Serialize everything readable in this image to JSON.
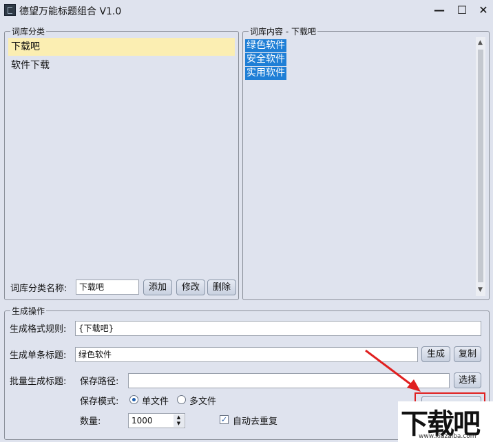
{
  "window": {
    "title": "德望万能标题组合 V1.0",
    "minimize": "—",
    "maximize": "☐",
    "close": "✕"
  },
  "category_panel": {
    "legend": "词库分类",
    "items": [
      "下载吧",
      "软件下载"
    ],
    "name_label": "词库分类名称:",
    "name_value": "下载吧",
    "add_label": "添加",
    "edit_label": "修改",
    "delete_label": "删除"
  },
  "content_panel": {
    "legend": "词库内容 - 下载吧",
    "lines": [
      "绿色软件",
      "安全软件",
      "实用软件"
    ]
  },
  "generate_panel": {
    "legend": "生成操作",
    "format_label": "生成格式规则:",
    "format_value": "{下载吧}",
    "single_label": "生成单条标题:",
    "single_value": "绿色软件",
    "generate_label": "生成",
    "copy_label": "复制",
    "batch_label": "批量生成标题:",
    "save_path_label": "保存路径:",
    "save_path_value": "",
    "choose_label": "选择",
    "save_mode_label": "保存模式:",
    "mode_single": "单文件",
    "mode_multi": "多文件",
    "count_label": "数量:",
    "count_value": "1000",
    "dedupe_label": "自动去重复"
  },
  "watermark": {
    "text": "下载吧",
    "url": "www.xiazaiba.com"
  },
  "colors": {
    "selection": "#fbeeb2",
    "highlight": "#1f7fd6",
    "annotation": "#e02020"
  }
}
